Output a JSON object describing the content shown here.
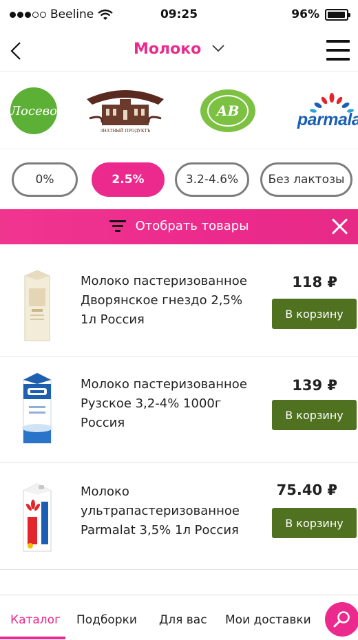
{
  "status_bar": {
    "carrier": "Beeline",
    "time": "09:25",
    "battery": "96%",
    "battery_level": 0.96,
    "signal_bars_filled": 3,
    "signal_bars_total": 5
  },
  "header": {
    "title": "Молоко",
    "back_icon": "chevron-left-icon",
    "dropdown_icon": "chevron-down-icon",
    "menu_icon": "hamburger-menu-icon"
  },
  "brands": [
    {
      "id": "losevo",
      "label": "Лосево"
    },
    {
      "id": "brest",
      "label": "Брест-Литовск",
      "tagline": "ЗНАТНЫЙ ПРОДУКТЪ"
    },
    {
      "id": "av",
      "label": "АВ"
    },
    {
      "id": "parmalat",
      "label": "parmalat"
    }
  ],
  "filters": [
    {
      "label": "0%",
      "active": false
    },
    {
      "label": "2.5%",
      "active": true
    },
    {
      "label": "3.2-4.6%",
      "active": false
    },
    {
      "label": "Без лактозы",
      "active": false
    }
  ],
  "filter_bar": {
    "label": "Отобрать товары",
    "filter_icon": "filter-icon",
    "close_icon": "close-icon"
  },
  "products": [
    {
      "name": "Молоко пастеризованное Дворянское гнездо 2,5% 1л Россия",
      "price": "118 ₽",
      "button": "В корзину"
    },
    {
      "name": "Молоко пастеризованное Рузское 3,2-4% 1000г Россия",
      "price": "139 ₽",
      "button": "В корзину"
    },
    {
      "name": "Молоко ультрапастеризованное Parmalat 3,5% 1л Россия",
      "price": "75.40 ₽",
      "button": "В корзину"
    }
  ],
  "bottom_nav": {
    "tabs": [
      {
        "label": "Каталог",
        "active": true
      },
      {
        "label": "Подборки",
        "active": false
      },
      {
        "label": "Для вас",
        "active": false
      },
      {
        "label": "Мои доставки",
        "active": false
      }
    ],
    "search_icon": "search-icon"
  },
  "colors": {
    "accent": "#ec2a8d",
    "cart_button": "#4f7120",
    "losevo_green": "#5bb035",
    "av_green": "#7cc142",
    "parmalat_blue": "#1b5fb4"
  }
}
